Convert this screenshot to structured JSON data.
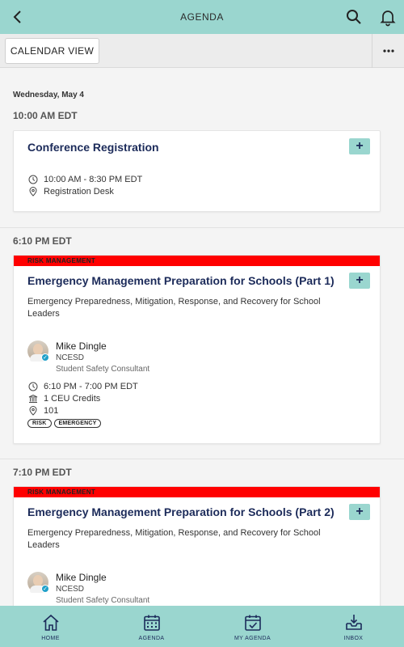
{
  "header": {
    "title": "AGENDA",
    "back_icon": "back-arrow-icon",
    "search_icon": "search-icon",
    "bell_icon": "bell-icon"
  },
  "toolbar": {
    "calendar_view_label": "CALENDAR VIEW",
    "more_icon": "more-dots-icon"
  },
  "date_heading": "Wednesday, May 4",
  "groups": [
    {
      "time": "10:00 AM EDT",
      "session": {
        "title": "Conference Registration",
        "add_label": "+",
        "time_range": "10:00 AM - 8:30 PM EDT",
        "location": "Registration Desk"
      }
    },
    {
      "time": "6:10 PM EDT",
      "session": {
        "track": "RISK MANAGEMENT",
        "title": "Emergency Management Preparation for Schools (Part 1)",
        "add_label": "+",
        "description": "Emergency Preparedness, Mitigation, Response, and Recovery for School Leaders",
        "speaker": {
          "name": "Mike Dingle",
          "org": "NCESD",
          "role": "Student Safety Consultant"
        },
        "time_range": "6:10 PM - 7:00 PM EDT",
        "credits": "1 CEU Credits",
        "location": "101",
        "tags": [
          "RISK",
          "EMERGENCY"
        ]
      }
    },
    {
      "time": "7:10 PM EDT",
      "session": {
        "track": "RISK MANAGEMENT",
        "title": "Emergency Management Preparation for Schools (Part 2)",
        "add_label": "+",
        "description": "Emergency Preparedness, Mitigation, Response, and Recovery for School Leaders",
        "speaker": {
          "name": "Mike Dingle",
          "org": "NCESD",
          "role": "Student Safety Consultant"
        }
      }
    }
  ],
  "bottom_nav": [
    {
      "label": "HOME",
      "icon": "home-icon"
    },
    {
      "label": "AGENDA",
      "icon": "calendar-icon"
    },
    {
      "label": "MY AGENDA",
      "icon": "calendar-check-icon"
    },
    {
      "label": "INBOX",
      "icon": "inbox-icon"
    }
  ],
  "colors": {
    "teal": "#9ad6cf",
    "navy": "#1c2b5a",
    "track_red": "#ff0000"
  }
}
